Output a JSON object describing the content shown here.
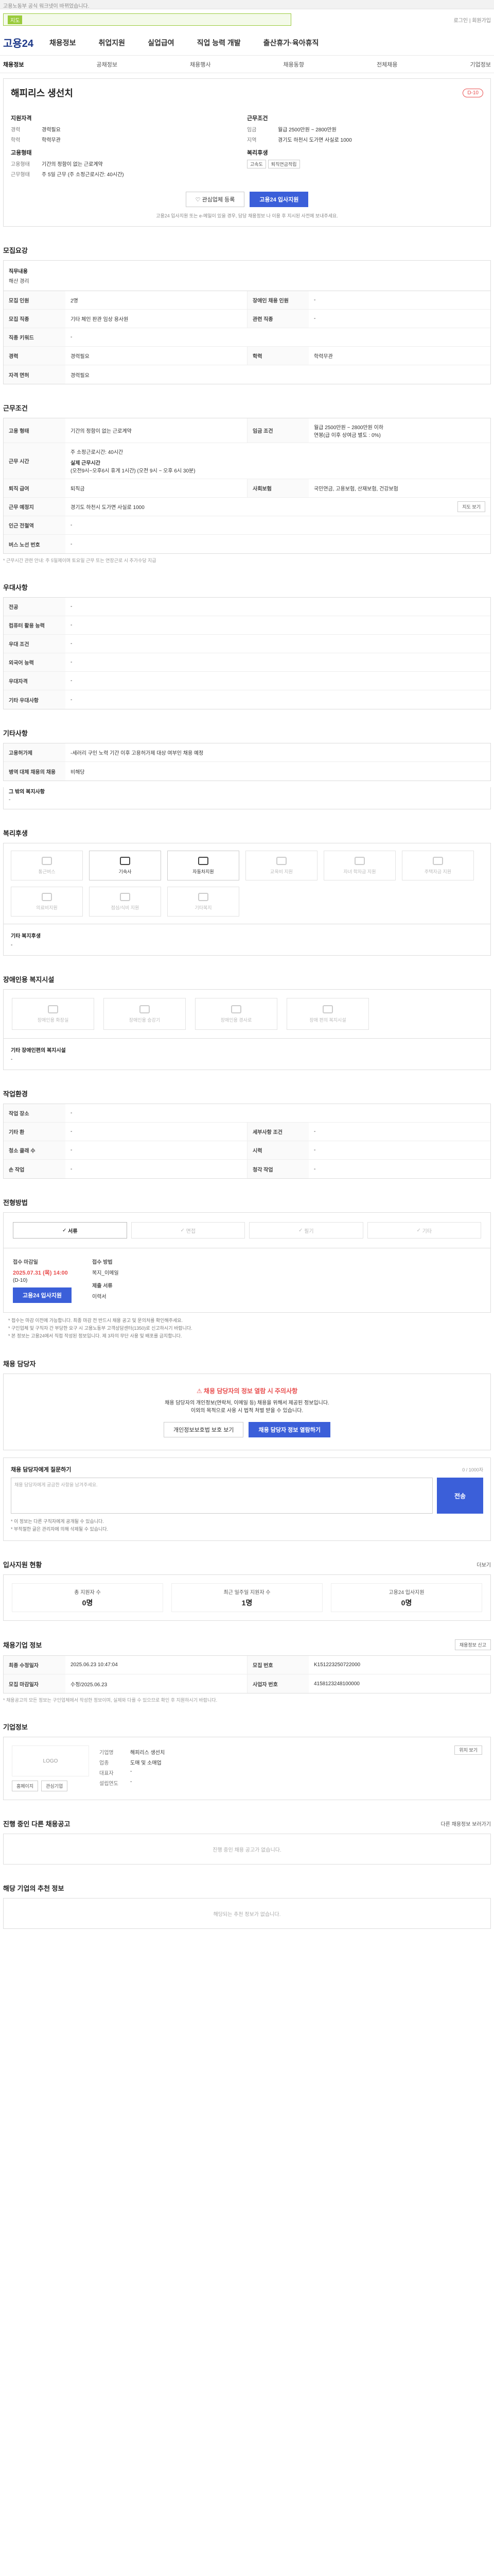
{
  "topbar": {
    "text": "고용노동부 공식 워크넷이 바뀌었습니다."
  },
  "search": {
    "tag": "지도",
    "placeholder": "",
    "util": "로그인 | 회원가입"
  },
  "gnb": {
    "logo": "고용24",
    "items": [
      "채용정보",
      "취업지원",
      "실업급여",
      "직업 능력 개발",
      "출산휴가·육아휴직"
    ]
  },
  "subnav": {
    "items": [
      "채용정보",
      "공채정보",
      "채용행사",
      "채용동향",
      "전체채용",
      "기업정보"
    ]
  },
  "summary": {
    "company": "해피리스 생선치",
    "dday": "D-10",
    "left_h": "지원자격",
    "left_kv": [
      {
        "k": "경력",
        "v": "경력필요"
      },
      {
        "k": "학력",
        "v": "학력무관"
      }
    ],
    "left_h2": "고용형태",
    "left_kv2": [
      {
        "k": "고용형태",
        "v": "기간의 정함이 없는 근로계약"
      },
      {
        "k": "근무형태",
        "v": "주 5일 근무 (주 소정근로시간: 40시간)"
      }
    ],
    "right_h": "근무조건",
    "right_kv": [
      {
        "k": "임금",
        "v": "월급 2500만원 ~ 2800만원"
      },
      {
        "k": "지역",
        "v": "경기도 하천시 도가면 사실로 1000"
      }
    ],
    "right_h2": "복리후생",
    "chips": [
      "고속도",
      "퇴직연금적립"
    ],
    "btn_fav": "관심업체 등록",
    "btn_apply": "고용24 입사지원",
    "note": "고용24 입사지원 또는 e-메일이 있을 경우, 담당 채용정보 나 이용 후 지시된 사전에 보내주세요."
  },
  "recruit": {
    "title": "모집요강",
    "job_h": "직무내용",
    "job_v": "해산 경리",
    "rows": [
      {
        "k": "모집 인원",
        "v": "2명",
        "k2": "장애인 채용 인원",
        "v2": "-"
      },
      {
        "k": "모집 직종",
        "v": "기타 체인 판관 임상 용사원",
        "k2": "관련 직종",
        "v2": "-"
      },
      {
        "k": "직종 키워드",
        "v": "-",
        "k2": "",
        "v2": ""
      },
      {
        "k": "경력",
        "v": "경력필요",
        "k2": "학력",
        "v2": "학력무관"
      },
      {
        "k": "자격 면허",
        "v": "경력필요",
        "k2": "",
        "v2": ""
      }
    ]
  },
  "work": {
    "title": "근무조건",
    "r1": {
      "k": "고용 형태",
      "v": "기간의 정함이 없는 근로계약",
      "k2": "임금 조건",
      "v2": "월급 2500만원 ~ 2800만원 이하\n연봉(급 이후 상여금 별도 : 0%)"
    },
    "r2_k": "근무 시간",
    "r2_v1": "주 소정근로시간: 40시간",
    "r2_v2": "실제 근무시간",
    "r2_v3": "(오전9시~오후6시 휴게 1시간) (오전 9시 ~ 오후 6시 30분)",
    "r3": {
      "k": "퇴직 급여",
      "v": "퇴직금",
      "k2": "사회보험",
      "v2": "국민연금, 고용보험, 산재보험, 건강보험"
    },
    "r4": {
      "k": "근무 예정지",
      "v": "경기도 하천시 도가면 사실로 1000",
      "btn": "지도 보기"
    },
    "r5_k": "인근 전철역",
    "r5_v": "-",
    "r6_k": "버스 노선 번호",
    "r6_v": "-",
    "note": "* 근무시간 관련 안내: 주 5일제이며 토요일 근무 또는 연장근로 시 추가수당 지급"
  },
  "pref": {
    "title": "우대사항",
    "rows": [
      {
        "k": "전공",
        "v": "-"
      },
      {
        "k": "컴퓨터 활용 능력",
        "v": "-"
      },
      {
        "k": "우대 조건",
        "v": "-"
      },
      {
        "k": "외국어 능력",
        "v": "-"
      },
      {
        "k": "우대자격",
        "v": "-"
      },
      {
        "k": "기타 우대사항",
        "v": "-"
      }
    ]
  },
  "etc": {
    "title": "기타사항",
    "rows": [
      {
        "k": "고용허가제",
        "v": "-세러리 구인 노력 기간 이후 고용허가제 대상 여부인 채용 예정"
      },
      {
        "k": "병역 대체 채용의 채용",
        "v": "비해당"
      }
    ],
    "sub_h": "그 밖의 복지사항",
    "sub_v": "-"
  },
  "welfare": {
    "title": "복리후생",
    "items": [
      {
        "label": "통근버스",
        "on": false
      },
      {
        "label": "기숙사",
        "on": true
      },
      {
        "label": "자동차지원",
        "on": true
      },
      {
        "label": "교육비 지원",
        "on": false
      },
      {
        "label": "자녀 학자금 지원",
        "on": false
      },
      {
        "label": "주택자금 지원",
        "on": false
      },
      {
        "label": "의료비지원",
        "on": false
      },
      {
        "label": "점심/식비 지원",
        "on": false
      },
      {
        "label": "기타복지",
        "on": false
      }
    ],
    "detail_h": "기타 복지후생",
    "detail_v": "-"
  },
  "disability": {
    "title": "장애인용 복지시설",
    "items": [
      "장애인용 화장실",
      "장애인용 승강기",
      "장애인용 경사로",
      "장애 편의 복지시설"
    ],
    "detail_h": "기타 장애인편의 복지시설",
    "detail_v": "-"
  },
  "env": {
    "title": "작업환경",
    "rows": [
      {
        "k": "작업 장소",
        "v": "-",
        "k2": "",
        "v2": ""
      },
      {
        "k": "기타 환",
        "v": "-",
        "k2": "세부사항 조건",
        "v2": "-"
      },
      {
        "k": "청소 클래 수",
        "v": "-",
        "k2": "시력",
        "v2": "-"
      },
      {
        "k": "손 작업",
        "v": "-",
        "k2": "청각 작업",
        "v2": "-"
      }
    ]
  },
  "process": {
    "title": "전형방법",
    "steps": [
      "서류",
      "면접",
      "필기",
      "기타"
    ],
    "apply_lbl": "접수 마감일",
    "apply_dt": "2025.07.31 (목) 14:00",
    "apply_sub": "(D-10)",
    "apply_btn": "고용24 입사지원",
    "method_lbl": "접수 방법",
    "method_v": "복지_이메일",
    "doc_lbl": "제출 서류",
    "doc_v": "이력서",
    "bullets": [
      "* 접수는 마감 이전에 가능합니다. 최종 마감 전 반드시 채용 공고 및 문의처를 확인해주세요.",
      "* 구인업체 및 구직자 간 부당한 요구 시 고용노동부 고객상담센터(1350)로 신고하시기 바랍니다.",
      "* 본 정보는 고용24에서 직접 작성된 정보입니다. 제 3자의 무단 사용 및 배포를 금지합니다."
    ]
  },
  "contact": {
    "title": "채용 담당자",
    "warn": "채용 담당자의 정보 열람 시 주의사항",
    "text1": "채용 담당자의 개인정보(연락처, 이메일 등) 채용을 위해서 제공된 정보입니다.",
    "text2": "이외의 목적으로 사용 시 법적 처벌 받을 수 있습니다.",
    "btn1": "개인정보보호법 보호 보기",
    "btn2": "채용 담당자 정보 열람하기",
    "inq_h": "채용 담당자에게 질문하기",
    "inq_count": "0 / 1000자",
    "inq_placeholder": "채용 담당자에게 궁금한 사항을 남겨주세요.",
    "inq_btn": "전송",
    "inq_notes": [
      "* 이 정보는 다른 구직자에게 공개될 수 있습니다.",
      "* 부적절한 글은 관리자에 의해 삭제될 수 있습니다."
    ]
  },
  "stats": {
    "title": "입사지원 현황",
    "more": "더보기",
    "items": [
      {
        "l": "총 지원자 수",
        "v": "0명"
      },
      {
        "l": "최근 일주일 지원자 수",
        "v": "1명"
      },
      {
        "l": "고용24 입사지원",
        "v": "0명"
      }
    ]
  },
  "info": {
    "title": "채용기업 정보",
    "btn": "채용정보 신고",
    "rows": [
      {
        "k": "최종 수정일자",
        "v": "2025.06.23 10:47:04",
        "k2": "모집 번호",
        "v2": "K151223250722000"
      },
      {
        "k": "모집 마감일자",
        "v": "수정/2025.06.23",
        "k2": "사업자 번호",
        "v2": "4158123248100000"
      }
    ],
    "note": "* 채용공고의 모든 정보는 구인업체에서 작성한 정보이며, 실제와 다를 수 있으므로 확인 후 지원하시기 바랍니다."
  },
  "company": {
    "title": "기업정보",
    "logo": "LOGO",
    "btn1": "홈페이지",
    "btn2": "관심기업",
    "kv": [
      {
        "k": "기업명",
        "v": "해피리스 생선치"
      },
      {
        "k": "업종",
        "v": "도매 및 소매업"
      },
      {
        "k": "대표자",
        "v": "-"
      },
      {
        "k": "설립연도",
        "v": "-"
      }
    ],
    "map_btn": "위치 보기"
  },
  "other": {
    "title": "진행 중인 다른 채용공고",
    "more": "다른 채용정보 보러가기",
    "empty": "진행 중인 채용 공고가 없습니다."
  },
  "reco": {
    "title": "해당 기업의 추천 정보",
    "empty": "해당되는 추천 정보가 없습니다."
  }
}
